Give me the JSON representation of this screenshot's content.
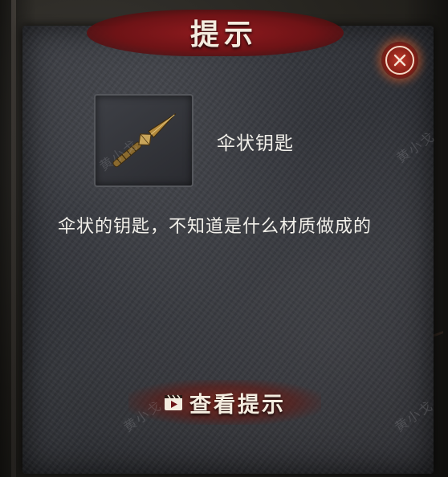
{
  "dialog": {
    "title": "提示",
    "close_icon": "close-x-icon"
  },
  "item": {
    "icon": "umbrella-shaped-key-icon",
    "name": "伞状钥匙",
    "description": "伞状的钥匙，不知道是什么材质做成的"
  },
  "actions": {
    "view_hint_label": "查看提示",
    "view_hint_icon": "video-play-icon"
  },
  "watermark": {
    "text": "黄小戈"
  },
  "colors": {
    "banner_red": "#8f1a1e",
    "close_glow": "#c0392b",
    "text_light": "#f2f0ea",
    "panel_dark": "#2e3036",
    "key_gold": "#b48a3c"
  }
}
